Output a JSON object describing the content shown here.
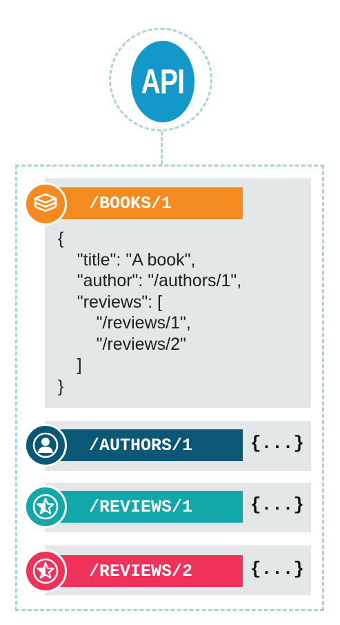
{
  "api": {
    "label": "API"
  },
  "colors": {
    "api": "#1497c9",
    "books": "#f48b20",
    "authors": "#0b5876",
    "reviews1": "#12a7a9",
    "reviews2": "#f0325a",
    "panel": "#e4e7e7",
    "dashed": "#a9d4d9"
  },
  "books": {
    "path": "/BOOKS/1",
    "icon": "books-stack-icon",
    "json_lines": [
      "{",
      "    \"title\": \"A book\",",
      "    \"author\": \"/authors/1\",",
      "    \"reviews\": [",
      "        \"/reviews/1\",",
      "        \"/reviews/2\"",
      "    ]",
      "}"
    ]
  },
  "resources": [
    {
      "path": "/AUTHORS/1",
      "icon": "user-icon",
      "collapsed": "{...}"
    },
    {
      "path": "/REVIEWS/1",
      "icon": "star-icon",
      "collapsed": "{...}"
    },
    {
      "path": "/REVIEWS/2",
      "icon": "star-icon",
      "collapsed": "{...}"
    }
  ]
}
